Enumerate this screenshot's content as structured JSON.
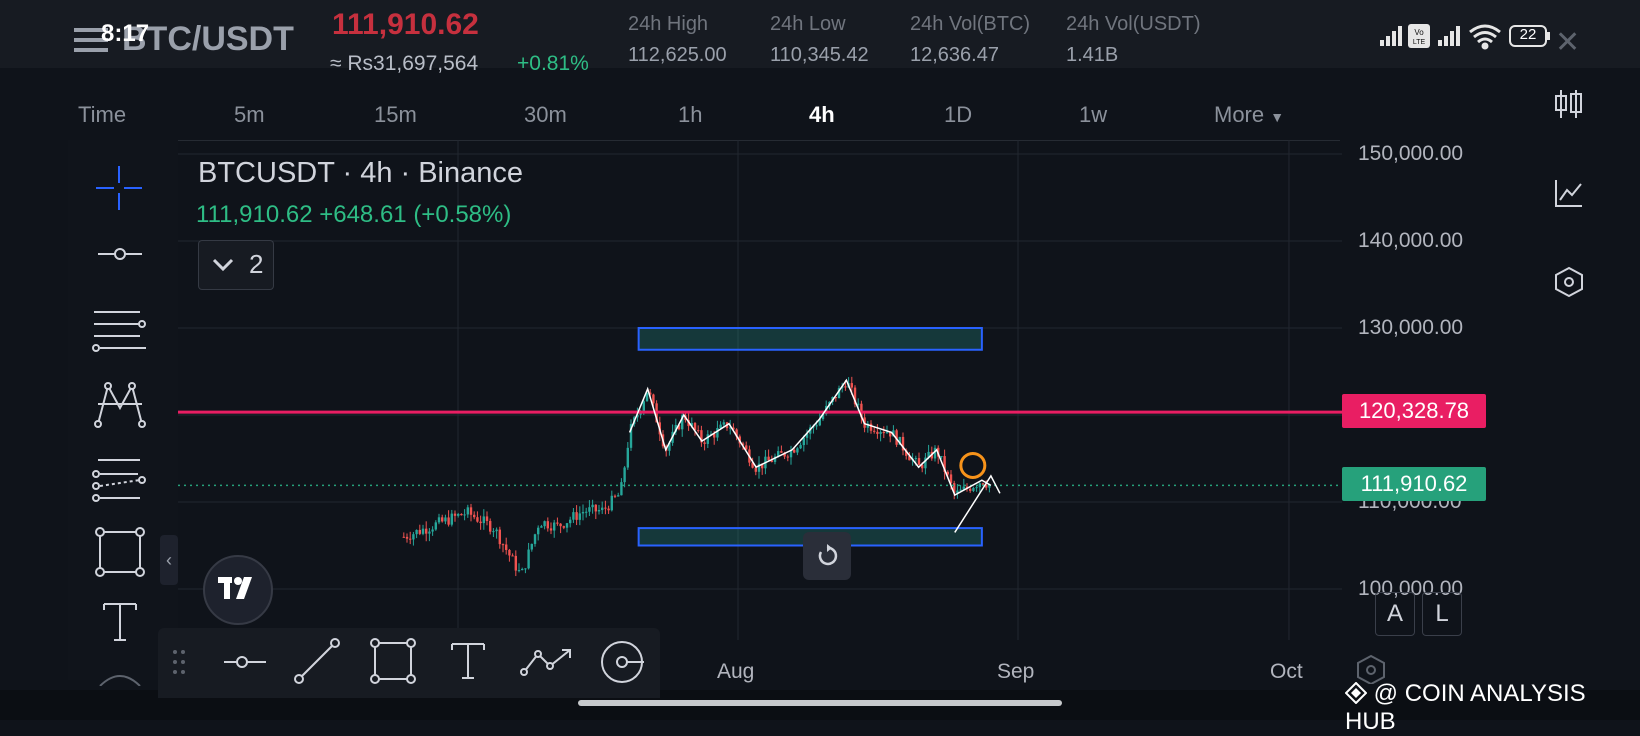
{
  "status_bar": {
    "time": "8:17",
    "battery": "22"
  },
  "header": {
    "pair": "BTC/USDT",
    "last_price": "111,910.62",
    "fiat_price": "≈ Rs31,697,564",
    "change_pct": "+0.81%",
    "stats": [
      {
        "label": "24h High",
        "value": "112,625.00"
      },
      {
        "label": "24h Low",
        "value": "110,345.42"
      },
      {
        "label": "24h Vol(BTC)",
        "value": "12,636.47"
      },
      {
        "label": "24h Vol(USDT)",
        "value": "1.41B"
      }
    ]
  },
  "timeframes": [
    {
      "label": "Time"
    },
    {
      "label": "5m"
    },
    {
      "label": "15m"
    },
    {
      "label": "30m"
    },
    {
      "label": "1h"
    },
    {
      "label": "4h",
      "active": true
    },
    {
      "label": "1D"
    },
    {
      "label": "1w"
    },
    {
      "label": "More"
    }
  ],
  "legend": {
    "title": "BTCUSDT · 4h · Binance",
    "ohlc": "111,910.62  +648.61 (+0.58%)",
    "indicator_count": "2"
  },
  "chart_data": {
    "type": "candlestick",
    "symbol": "BTCUSDT",
    "interval": "4h",
    "exchange": "Binance",
    "y_ticks": [
      "150,000.00",
      "140,000.00",
      "130,000.00",
      "110,000.00",
      "100,000.00"
    ],
    "x_ticks": [
      "Aug",
      "Sep",
      "Oct"
    ],
    "ylim": [
      98500,
      150000
    ],
    "approx_path": [
      {
        "date": "2025-06-25",
        "close": 106000
      },
      {
        "date": "2025-07-02",
        "close": 108800
      },
      {
        "date": "2025-07-05",
        "close": 107000
      },
      {
        "date": "2025-07-08",
        "close": 101500
      },
      {
        "date": "2025-07-10",
        "close": 107800
      },
      {
        "date": "2025-07-12",
        "close": 107200
      },
      {
        "date": "2025-07-15",
        "close": 109000
      },
      {
        "date": "2025-07-17",
        "close": 109000
      },
      {
        "date": "2025-07-19",
        "close": 111000
      },
      {
        "date": "2025-07-20",
        "close": 118000
      },
      {
        "date": "2025-07-22",
        "close": 123000
      },
      {
        "date": "2025-07-24",
        "close": 116000
      },
      {
        "date": "2025-07-26",
        "close": 120000
      },
      {
        "date": "2025-07-28",
        "close": 117000
      },
      {
        "date": "2025-07-31",
        "close": 119000
      },
      {
        "date": "2025-08-03",
        "close": 114000
      },
      {
        "date": "2025-08-07",
        "close": 116000
      },
      {
        "date": "2025-08-10",
        "close": 119500
      },
      {
        "date": "2025-08-13",
        "close": 124000
      },
      {
        "date": "2025-08-15",
        "close": 119000
      },
      {
        "date": "2025-08-18",
        "close": 118000
      },
      {
        "date": "2025-08-21",
        "close": 114000
      },
      {
        "date": "2025-08-23",
        "close": 116000
      },
      {
        "date": "2025-08-25",
        "close": 110800
      },
      {
        "date": "2025-08-28",
        "close": 112500
      },
      {
        "date": "2025-08-29",
        "close": 111910.62
      }
    ],
    "last_price_tag": "111,910.62",
    "resistance_tag": "120,328.78",
    "resistance": 120328.78,
    "zones": [
      {
        "from": "2025-07-21",
        "to": "2025-08-28",
        "low": 127500,
        "high": 130000
      },
      {
        "from": "2025-07-21",
        "to": "2025-08-28",
        "low": 105000,
        "high": 107000
      }
    ],
    "colors": {
      "up": "#26a69a",
      "down": "#ef5350",
      "resistance": "#e91e63",
      "zone": "#2962ff",
      "price_line": "#26a17b"
    }
  },
  "right_tools": [
    "chart-style-icon",
    "indicators-icon",
    "settings-icon"
  ],
  "left_tools": [
    "crosshair-icon",
    "horizontal-line-icon",
    "fib-icon",
    "pattern-icon",
    "channel-icon",
    "rectangle-icon",
    "text-icon"
  ],
  "bottom_tools": [
    "drag-handle-icon",
    "horizontal-ray-icon",
    "trend-line-icon",
    "rectangle-icon",
    "text-icon",
    "path-icon",
    "more-icon"
  ],
  "toggles": {
    "auto": "A",
    "log": "L"
  },
  "watermark": "@ COIN ANALYSIS HUB"
}
